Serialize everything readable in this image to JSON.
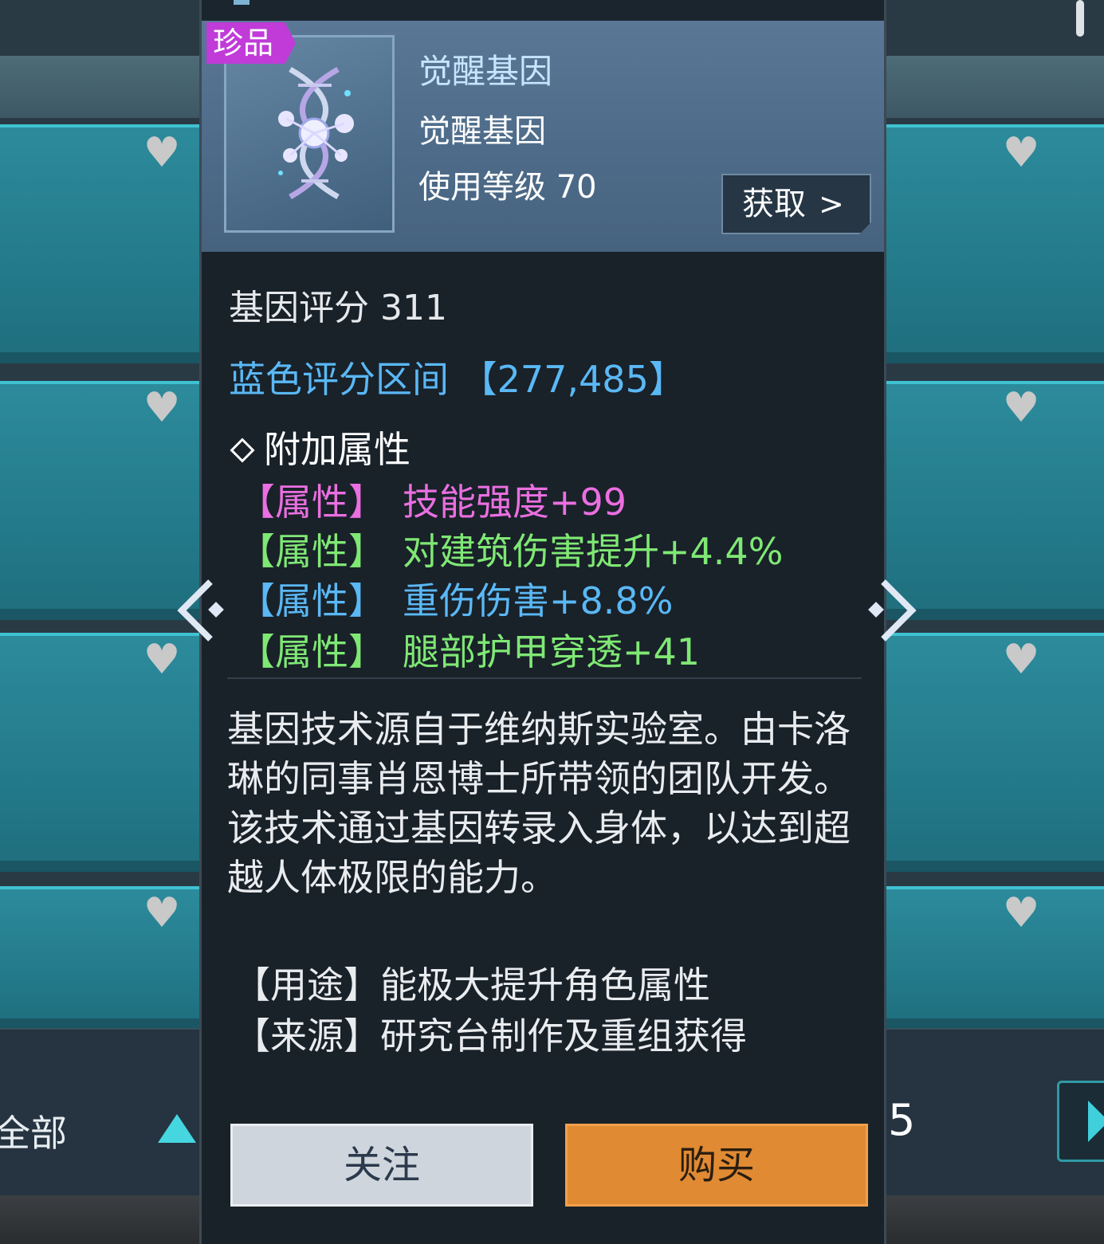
{
  "background": {
    "filter_label": "全部",
    "page_number": "5"
  },
  "item": {
    "rarity": "珍品",
    "name": "觉醒基因",
    "type": "觉醒基因",
    "level_text": "使用等级 70",
    "obtain_label": "获取",
    "obtain_chevron": ">"
  },
  "stats": {
    "score_text": "基因评分 311",
    "range_text": "蓝色评分区间 【277,485】",
    "extra_title": "附加属性",
    "attributes": [
      {
        "tag": "【属性】",
        "text": "技能强度+99",
        "color": "#ea6fe0"
      },
      {
        "tag": "【属性】",
        "text": "对建筑伤害提升+4.4%",
        "color": "#7fe874"
      },
      {
        "tag": "【属性】",
        "text": "重伤伤害+8.8%",
        "color": "#5ab8f5"
      },
      {
        "tag": "【属性】",
        "text": "腿部护甲穿透+41",
        "color": "#7fe874"
      }
    ]
  },
  "description": "基因技术源自于维纳斯实验室。由卡洛琳的同事肖恩博士所带领的团队开发。该技术通过基因转录入身体，以达到超越人体极限的能力。",
  "usage": "【用途】能极大提升角色属性",
  "source": "【来源】研究台制作及重组获得",
  "buttons": {
    "follow": "关注",
    "buy": "购买"
  },
  "colors": {
    "accent_cyan": "#3fc2d2",
    "buy_orange": "#e08a33",
    "rarity_purple": "#c03bd8"
  },
  "icons": {
    "heart": "heart-icon",
    "dna": "dna-icon",
    "prev": "chevron-left-icon",
    "next": "chevron-right-icon"
  }
}
